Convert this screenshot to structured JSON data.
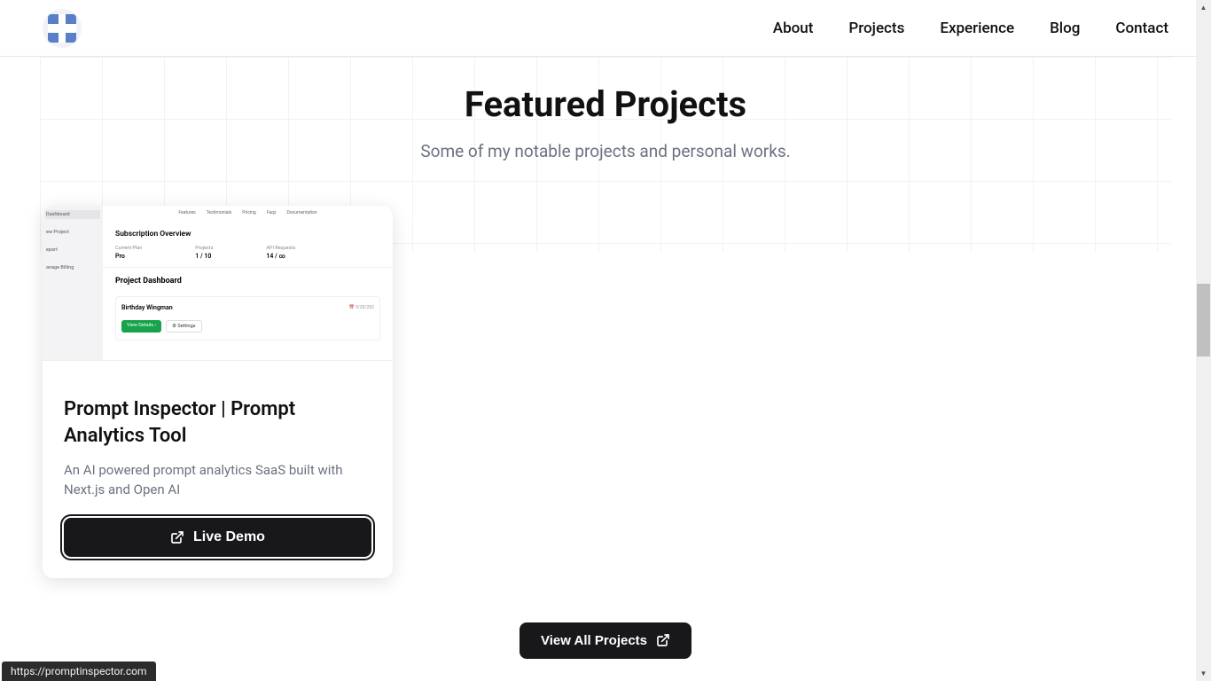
{
  "nav": {
    "items": [
      "About",
      "Projects",
      "Experience",
      "Blog",
      "Contact"
    ]
  },
  "hero": {
    "title": "Featured Projects",
    "subtitle": "Some of my notable projects and personal works."
  },
  "project": {
    "title": "Prompt Inspector | Prompt Analytics Tool",
    "description": "An AI powered prompt analytics SaaS built with Next.js and Open AI",
    "liveDemoLabel": "Live Demo",
    "screenshot": {
      "sidebar": [
        "Dashboard",
        "ew Project",
        "eport",
        "anage Billing"
      ],
      "topnav": [
        "Features",
        "Testimonials",
        "Pricing",
        "Faqs",
        "Documentation"
      ],
      "subscription": {
        "title": "Subscription Overview",
        "stats": [
          {
            "label": "Current Plan",
            "value": "Pro"
          },
          {
            "label": "Projects",
            "value": "1 / 10"
          },
          {
            "label": "API Requests",
            "value": "14 / ∞"
          }
        ]
      },
      "dashboard": {
        "title": "Project Dashboard",
        "project": {
          "name": "Birthday Wingman",
          "date": "9/20/202",
          "viewDetails": "View Details",
          "settings": "Settings"
        }
      }
    }
  },
  "viewAllLabel": "View All Projects",
  "statusBar": "https://promptinspector.com"
}
